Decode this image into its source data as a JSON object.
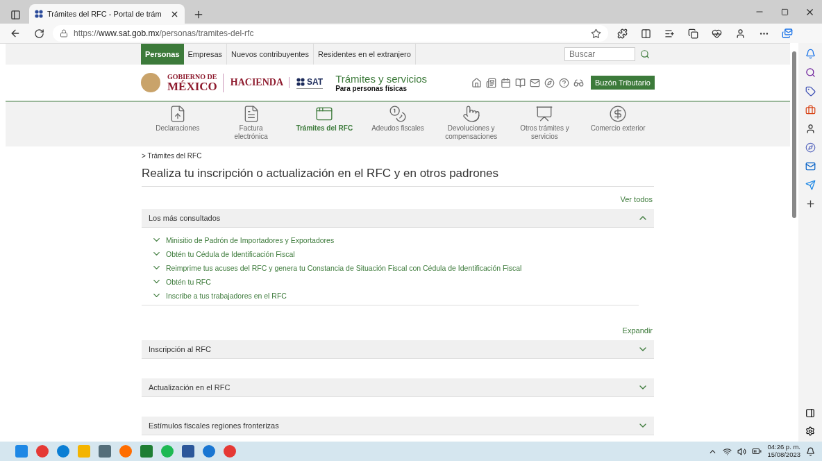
{
  "browser": {
    "tab": {
      "title": "Trámites del RFC - Portal de trám",
      "selected": true
    },
    "url": "https://**www.sat.gob.mx**/personas/tramites-del-rfc"
  },
  "top_nav": {
    "items": [
      {
        "label": "Personas",
        "selected": true
      },
      {
        "label": "Empresas",
        "selected": false
      },
      {
        "label": "Nuevos contribuyentes",
        "selected": false
      },
      {
        "label": "Residentes en el extranjero",
        "selected": false
      }
    ],
    "search": {
      "placeholder": "Buscar"
    }
  },
  "header": {
    "logo": {
      "line_1": "GOBIERNO DE",
      "line_2": "MÉXICO"
    },
    "hacienda": "HACIENDA",
    "sat": "SAT",
    "title": "Trámites y servicios",
    "subtitle": "Para personas físicas",
    "button": "Buzón Tributario"
  },
  "categories": [
    {
      "label": "Declaraciones",
      "selected": false
    },
    {
      "label": "Factura electrónica",
      "selected": false
    },
    {
      "label": "Trámites del RFC",
      "selected": true
    },
    {
      "label": "Adeudos fiscales",
      "selected": false
    },
    {
      "label": "Devoluciones y compensaciones",
      "selected": false
    },
    {
      "label": "Otros trámites y servicios",
      "selected": false
    },
    {
      "label": "Comercio exterior",
      "selected": false
    }
  ],
  "breadcrumb": "> Trámites del RFC",
  "heading": "Realiza tu inscripción o actualización en el RFC y en otros padrones",
  "see_all": "Ver todos",
  "featured": {
    "title": "Los más consultados",
    "expanded": true,
    "links": [
      "Minisitio de Padrón de Importadores y Exportadores",
      "Obtén tu Cédula de Identificación Fiscal",
      "Reimprime tus acuses del RFC y genera tu Constancia de Situación Fiscal con Cédula de Identificación Fiscal",
      "Obtén tu RFC",
      "Inscribe a tus trabajadores en el RFC"
    ]
  },
  "expand": "Expandir",
  "sections": [
    {
      "title": "Inscripción al RFC",
      "expanded": false
    },
    {
      "title": "Actualización en el RFC",
      "expanded": false
    },
    {
      "title": "Estímulos fiscales regiones fronterizas",
      "expanded": false
    }
  ],
  "taskbar": {
    "time": "04:26 p. m.",
    "date": "15/08/2023"
  }
}
